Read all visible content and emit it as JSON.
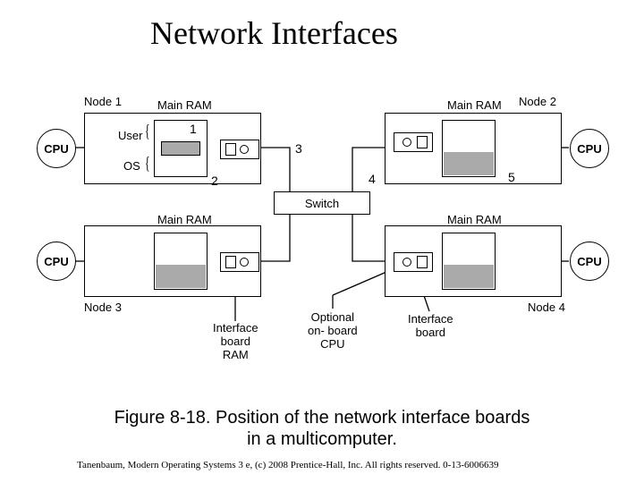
{
  "title": "Network Interfaces",
  "caption_line1": "Figure 8-18. Position of the network interface boards",
  "caption_line2": "in a multicomputer.",
  "footer": "Tanenbaum, Modern Operating Systems 3 e, (c) 2008 Prentice-Hall, Inc. All rights reserved. 0-13-6006639",
  "labels": {
    "node1": "Node 1",
    "node2": "Node 2",
    "node3": "Node 3",
    "node4": "Node 4",
    "cpu": "CPU",
    "main_ram": "Main RAM",
    "user": "User",
    "os": "OS",
    "switch": "Switch",
    "optional_cpu_line1": "Optional",
    "optional_cpu_line2": "on- board",
    "optional_cpu_line3": "CPU",
    "interface_board_line1": "Interface",
    "interface_board_line2": "board",
    "ifb_ram_line1": "Interface",
    "ifb_ram_line2": "board",
    "ifb_ram_line3": "RAM"
  },
  "numbers": {
    "n1": "1",
    "n2": "2",
    "n3": "3",
    "n4": "4",
    "n5": "5"
  }
}
